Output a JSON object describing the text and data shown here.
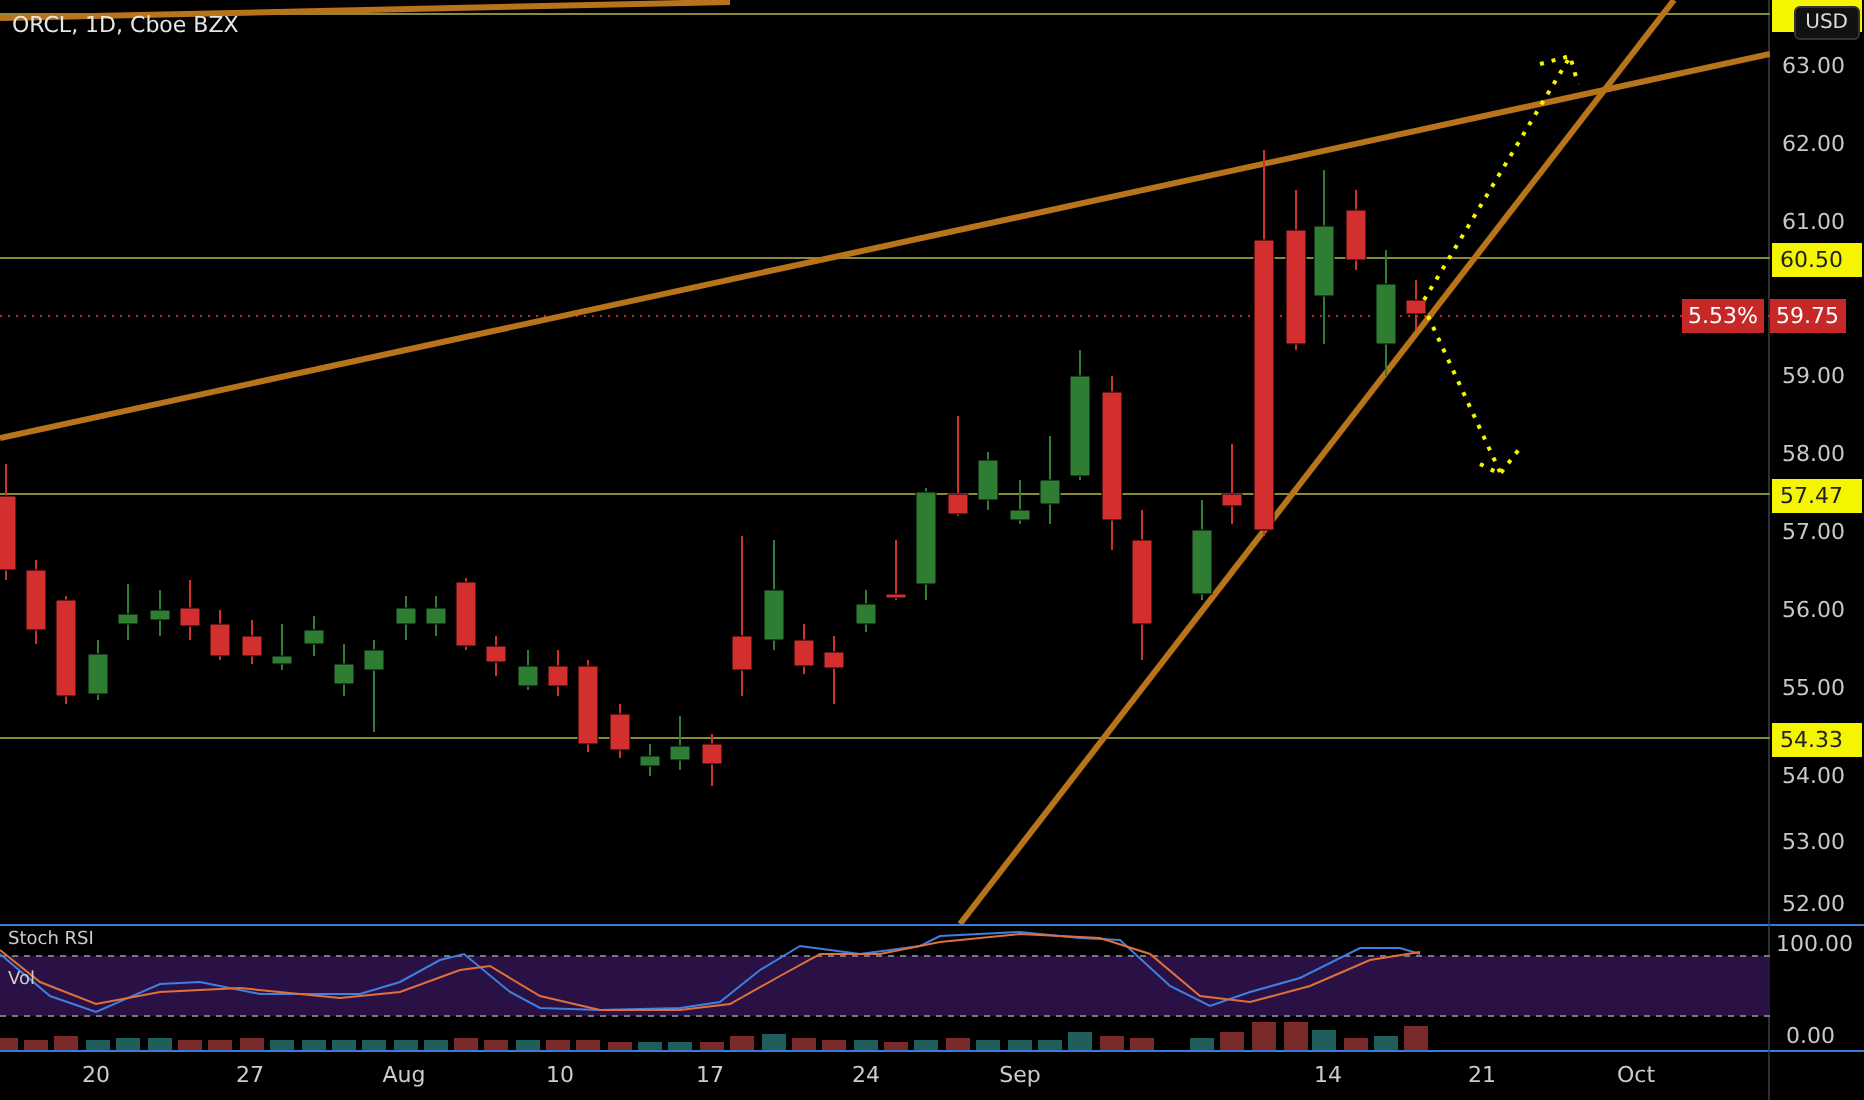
{
  "header": {
    "symbol": "ORCL, 1D, Cboe BZX"
  },
  "currency_button": {
    "label": "USD"
  },
  "price_axis": {
    "ticks": [
      "63.00",
      "62.00",
      "61.00",
      "59.00",
      "58.00",
      "57.00",
      "56.00",
      "55.00",
      "54.00",
      "53.00",
      "52.00"
    ]
  },
  "level_labels": [
    "60.50",
    "57.47",
    "54.33"
  ],
  "current_price": {
    "change": "5.53%",
    "price": "59.75"
  },
  "indicator": {
    "title": "Stoch RSI",
    "subtitle": "Vol",
    "ticks": [
      "100.00",
      "0.00"
    ]
  },
  "date_axis": [
    "20",
    "27",
    "Aug",
    "10",
    "17",
    "24",
    "Sep",
    "14",
    "21",
    "Oct"
  ]
}
